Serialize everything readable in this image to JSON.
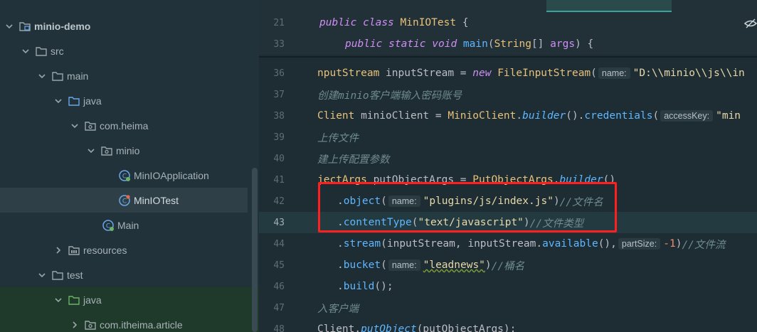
{
  "tree": {
    "project": "minio-demo",
    "src": "src",
    "main": "main",
    "java": "java",
    "pkg": "com.heima",
    "pkg_sub": "minio",
    "app_class": "MinIOApplication",
    "test_class": "MinIOTest",
    "main_class": "Main",
    "resources": "resources",
    "test": "test",
    "test_java": "java",
    "test_pkg": "com.itheima.article"
  },
  "editor": {
    "sticky": [
      {
        "ln": "21",
        "kw1": "public",
        "kw2": "class",
        "cls": "MinIOTest",
        "rest": " {"
      },
      {
        "ln": "33",
        "kw1": "public",
        "kw2": "static",
        "kw3": "void",
        "fn": "main",
        "p1": "(",
        "cls": "String",
        "p2": "[] ",
        "arg": "args",
        "p3": ") {"
      }
    ],
    "lines": {
      "l36": {
        "ln": "36",
        "a": "nputStream",
        "b": " inputStream = ",
        "kw": "new",
        "c": " ",
        "fn": "FileInputStream",
        "d": "(",
        "hint": "name:",
        "str": "\"D:\\\\minio\\\\js\\\\in"
      },
      "l37": {
        "ln": "37",
        "cmt": "创建minio客户端输入密码账号"
      },
      "l38": {
        "ln": "38",
        "a": "Client",
        "b": " minioClient = ",
        "cls": "MinioClient",
        "c": ".",
        "fn": "builder",
        "d": "().",
        "fn2": "credentials",
        "e": "(",
        "hint": "accessKey:",
        "str": "\"min"
      },
      "l39": {
        "ln": "39",
        "cmt": "上传文件"
      },
      "l40": {
        "ln": "40",
        "cmt": "建上传配置参数"
      },
      "l41": {
        "ln": "41",
        "a": "jectArgs",
        "b": " putObjectArgs = ",
        "cls": "PutObjectArgs",
        "c": ".",
        "fn": "builder",
        "d": "()"
      },
      "l42": {
        "ln": "42",
        "a": ".",
        "fn": "object",
        "b": "(",
        "hint": "name:",
        "str": "\"plugins/js/index.js\"",
        "c": ")",
        "cmt": "//文件名"
      },
      "l43": {
        "ln": "43",
        "a": ".",
        "fn": "contentType",
        "b": "(",
        "str": "\"text/javascript\"",
        "c": ")",
        "cmt": "//文件类型"
      },
      "l44": {
        "ln": "44",
        "a": ".",
        "fn": "stream",
        "b": "(inputStream, inputStream.",
        "fn2": "available",
        "c": "(),",
        "hint": "partSize:",
        "num": "-1",
        "d": ")",
        "cmt": "//文件流"
      },
      "l45": {
        "ln": "45",
        "a": ".",
        "fn": "bucket",
        "b": "(",
        "hint": "name:",
        "str": "\"leadnews\"",
        "c": ")",
        "cmt": "//桶名"
      },
      "l46": {
        "ln": "46",
        "a": ".",
        "fn": "build",
        "b": "();"
      },
      "l47": {
        "ln": "47",
        "cmt": "入客户端"
      },
      "l48": {
        "ln": "48",
        "a": "Client.",
        "fn": "putObject",
        "b": "(putObjectArgs);"
      }
    }
  },
  "colors": {
    "highlight_box": "#ff1f1f",
    "keyword": "#cf8ef4",
    "class": "#e8c17a",
    "method": "#5fb7ff",
    "string": "#e8d9a8",
    "comment": "#6f8c8f"
  },
  "icons": [
    "chevron-down-icon",
    "chevron-right-icon",
    "folder-icon",
    "package-icon",
    "class-icon",
    "eye-off-icon"
  ]
}
